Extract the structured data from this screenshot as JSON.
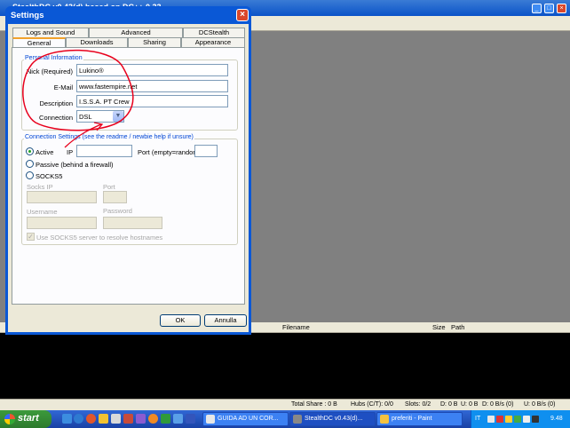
{
  "app": {
    "title": "StealthDC v0.43(d) based on DC++ 0.33",
    "list_headers": {
      "filename": "Filename",
      "size": "Size",
      "path": "Path"
    },
    "status": {
      "total_share": "Total Share : 0 B",
      "hubs": "Hubs (C/T): 0/0",
      "slots": "Slots: 0/2",
      "d": "D: 0 B",
      "u": "U: 0 B",
      "d_rate": "D: 0 B/s (0)",
      "u_rate": "U: 0 B/s (0)"
    }
  },
  "taskbar": {
    "start_label": "start",
    "buttons": [
      {
        "label": "GUIDA AD UN COR...",
        "active": false
      },
      {
        "label": "StealthDC v0.43(d)...",
        "active": true
      },
      {
        "label": "preferiti - Paint",
        "active": false
      }
    ],
    "language": "IT",
    "clock": "9.48"
  },
  "dialog": {
    "title": "Settings",
    "tabs_row1": [
      "Logs and Sound",
      "Advanced",
      "DCStealth"
    ],
    "tabs_row2": [
      "General",
      "Downloads",
      "Sharing",
      "Appearance"
    ],
    "selected_tab": "General",
    "personal": {
      "legend": "Personal Information",
      "nick_label": "Nick (Required)",
      "nick_value": "Lukino®",
      "email_label": "E-Mail",
      "email_value": "www.fastempire.net",
      "description_label": "Description",
      "description_value": "I.S.S.A. PT Crew",
      "connection_label": "Connection",
      "connection_value": "DSL"
    },
    "connection": {
      "legend": "Connection Settings (see the readme / newbie help if unsure)",
      "active_label": "Active",
      "ip_label": "IP",
      "port_label": "Port (empty=random)",
      "passive_label": "Passive (behind a firewall)",
      "socks5_label": "SOCKS5",
      "socks_ip_label": "Socks IP",
      "socks_port_label": "Port",
      "username_label": "Username",
      "password_label": "Password",
      "resolve_label": "Use SOCKS5 server to resolve hostnames",
      "selected_mode": "Active"
    },
    "buttons": {
      "ok": "OK",
      "cancel": "Annulla"
    }
  },
  "colors": {
    "annotation": "#e8001c",
    "dialog_frame": "#0a58d6",
    "tab_highlight": "#f1a22c",
    "legend": "#0046d5"
  }
}
